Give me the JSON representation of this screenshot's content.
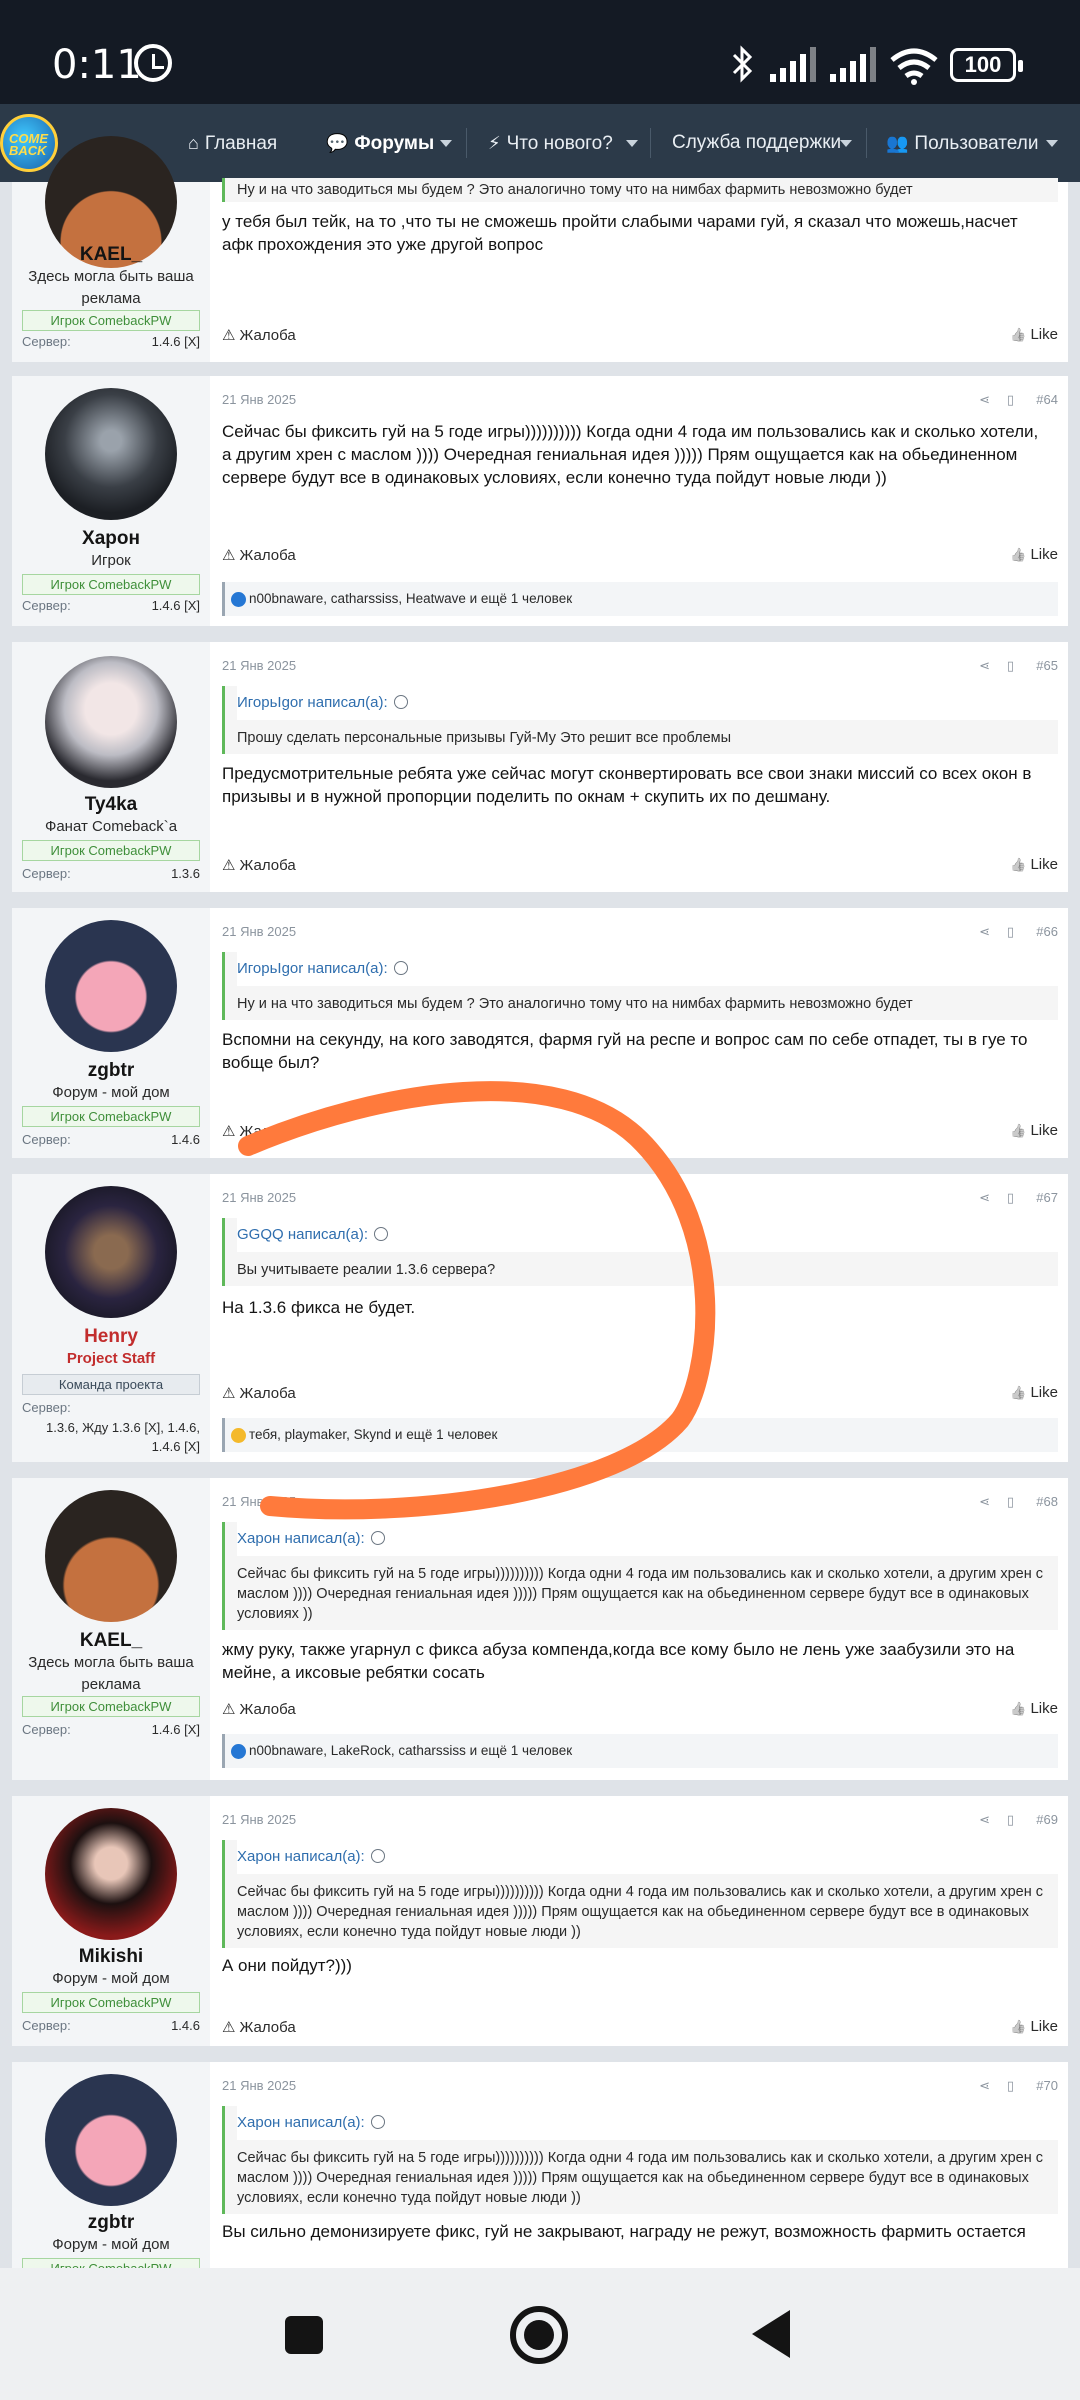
{
  "status_bar": {
    "time": "0:11",
    "battery": "100"
  },
  "navbar": {
    "logo_text": "COME BACK",
    "items": [
      {
        "label": "Главная",
        "icon": "home-icon"
      },
      {
        "label": "Форумы",
        "icon": "chat-icon"
      },
      {
        "label": "Что нового?",
        "icon": "bolt-icon"
      },
      {
        "label": "Служба поддержки",
        "icon": ""
      },
      {
        "label": "Пользователи",
        "icon": "users-icon"
      }
    ]
  },
  "labels": {
    "server": "Сервер:",
    "report": "Жалоба",
    "like": "Like"
  },
  "posts": [
    {
      "author": "KAEL_",
      "title": "Здесь могла быть ваша реклама",
      "badge": "Игрок ComebackPW",
      "server": "1.4.6 [X]",
      "quote_head": "",
      "quote_text": "Ну и на что заводиться мы будем ? Это аналогично тому что на нимбах фармить невозможно будет",
      "text": "у тебя был тейк, на то ,что ты не сможешь пройти слабыми чарами гуй, я сказал что можешь,насчет афк прохождения это уже другой вопрос"
    },
    {
      "author": "Харон",
      "title": "Игрок",
      "badge": "Игрок ComebackPW",
      "server": "1.4.6 [X]",
      "date": "21 Янв 2025",
      "num": "#64",
      "text": "Сейчас бы фиксить гуй на 5 годе игры)))))))))) Когда одни 4 года им пользовались как и сколько хотели, а другим хрен с маслом )))) Очередная гениальная идея ))))) Прям ощущается как на обьединенном сервере будут все в одинаковых условиях, если конечно туда пойдут новые люди ))",
      "reactions": "n00bnaware, catharssiss, Heatwave и ещё 1 человек"
    },
    {
      "author": "Ty4ka",
      "title": "Фанат Comeback`a",
      "badge": "Игрок ComebackPW",
      "server": "1.3.6",
      "date": "21 Янв 2025",
      "num": "#65",
      "quote_head": "ИгорьIgor написал(а):",
      "quote_text": "Прошу сделать персональные призывы Гуй-Му Это решит все проблемы",
      "text": "Предусмотрительные ребята уже сейчас могут сконвертировать все свои знаки миссий со всех окон в призывы и в нужной пропорции поделить по окнам + скупить их по дешману."
    },
    {
      "author": "zgbtr",
      "title": "Форум - мой дом",
      "badge": "Игрок ComebackPW",
      "server": "1.4.6",
      "date": "21 Янв 2025",
      "num": "#66",
      "quote_head": "ИгорьIgor написал(а):",
      "quote_text": "Ну и на что заводиться мы будем ? Это аналогично тому что на нимбах фармить невозможно будет",
      "text": "Вспомни на секунду, на кого заводятся, фармя гуй на респе и вопрос сам по себе отпадет, ты в гуе то вобще был?"
    },
    {
      "author": "Henry",
      "title": "Project Staff",
      "badge": "Команда проекта",
      "server": "1.3.6, Жду 1.3.6 [X], 1.4.6, 1.4.6 [X]",
      "date": "21 Янв 2025",
      "num": "#67",
      "quote_head": "GGQQ написал(а):",
      "quote_text": "Вы учитываете реалии 1.3.6 сервера?",
      "text": "На 1.3.6 фикса не будет.",
      "reactions": "тебя, playmaker, Skynd и ещё 1 человек"
    },
    {
      "author": "KAEL_",
      "title": "Здесь могла быть ваша реклама",
      "badge": "Игрок ComebackPW",
      "server": "1.4.6 [X]",
      "date": "21 Янв 2025",
      "num": "#68",
      "quote_head": "Харон написал(а):",
      "quote_text": "Сейчас бы фиксить гуй на 5 годе игры)))))))))) Когда одни 4 года им пользовались как и сколько хотели, а другим хрен с маслом )))) Очередная гениальная идея ))))) Прям ощущается как на обьединенном сервере будут все в одинаковых условиях ))",
      "text": "жму руку, также угарнул с фикса абуза компенда,когда все кому было не лень уже заабузили это на мейне, а иксовые ребятки сосать",
      "reactions": "n00bnaware, LakeRock, catharssiss и ещё 1 человек"
    },
    {
      "author": "Mikishi",
      "title": "Форум - мой дом",
      "badge": "Игрок ComebackPW",
      "server": "1.4.6",
      "date": "21 Янв 2025",
      "num": "#69",
      "quote_head": "Харон написал(а):",
      "quote_text": "Сейчас бы фиксить гуй на 5 годе игры)))))))))) Когда одни 4 года им пользовались как и сколько хотели, а другим хрен с маслом )))) Очередная гениальная идея ))))) Прям ощущается как на обьединенном сервере будут все в одинаковых условиях, если конечно туда пойдут новые люди ))",
      "text": "А они пойдут?)))"
    },
    {
      "author": "zgbtr",
      "title": "Форум - мой дом",
      "badge": "Игрок ComebackPW",
      "server": "",
      "date": "21 Янв 2025",
      "num": "#70",
      "quote_head": "Харон написал(а):",
      "quote_text": "Сейчас бы фиксить гуй на 5 годе игры)))))))))) Когда одни 4 года им пользовались как и сколько хотели, а другим хрен с маслом )))) Очередная гениальная идея ))))) Прям ощущается как на обьединенном сервере будут все в одинаковых условиях, если конечно туда пойдут новые люди ))",
      "text": "Вы сильно демонизируете фикс, гуй не закрывают, награду не режут, возможность фармить остается"
    }
  ]
}
